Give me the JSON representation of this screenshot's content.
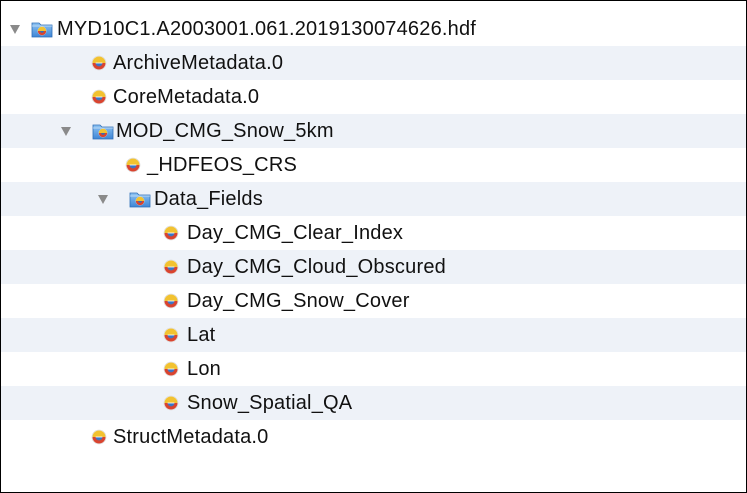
{
  "tree": {
    "root": {
      "label": "MYD10C1.A2003001.061.2019130074626.hdf",
      "expanded": true
    },
    "items": [
      {
        "label": "ArchiveMetadata.0"
      },
      {
        "label": "CoreMetadata.0"
      },
      {
        "label": "MOD_CMG_Snow_5km",
        "expanded": true
      },
      {
        "label": "_HDFEOS_CRS"
      },
      {
        "label": "Data_Fields",
        "expanded": true
      },
      {
        "label": "Day_CMG_Clear_Index"
      },
      {
        "label": "Day_CMG_Cloud_Obscured"
      },
      {
        "label": "Day_CMG_Snow_Cover"
      },
      {
        "label": "Lat"
      },
      {
        "label": "Lon"
      },
      {
        "label": "Snow_Spatial_QA"
      },
      {
        "label": "StructMetadata.0"
      }
    ]
  },
  "colors": {
    "alt_row": "#eef2f8",
    "disclosure": "#8a8a8a",
    "border": "#000000"
  },
  "icons": {
    "group": "hdf-group-folder-icon",
    "dataset": "hdf-dataset-icon",
    "disclosure": "disclosure-triangle-down-icon"
  }
}
